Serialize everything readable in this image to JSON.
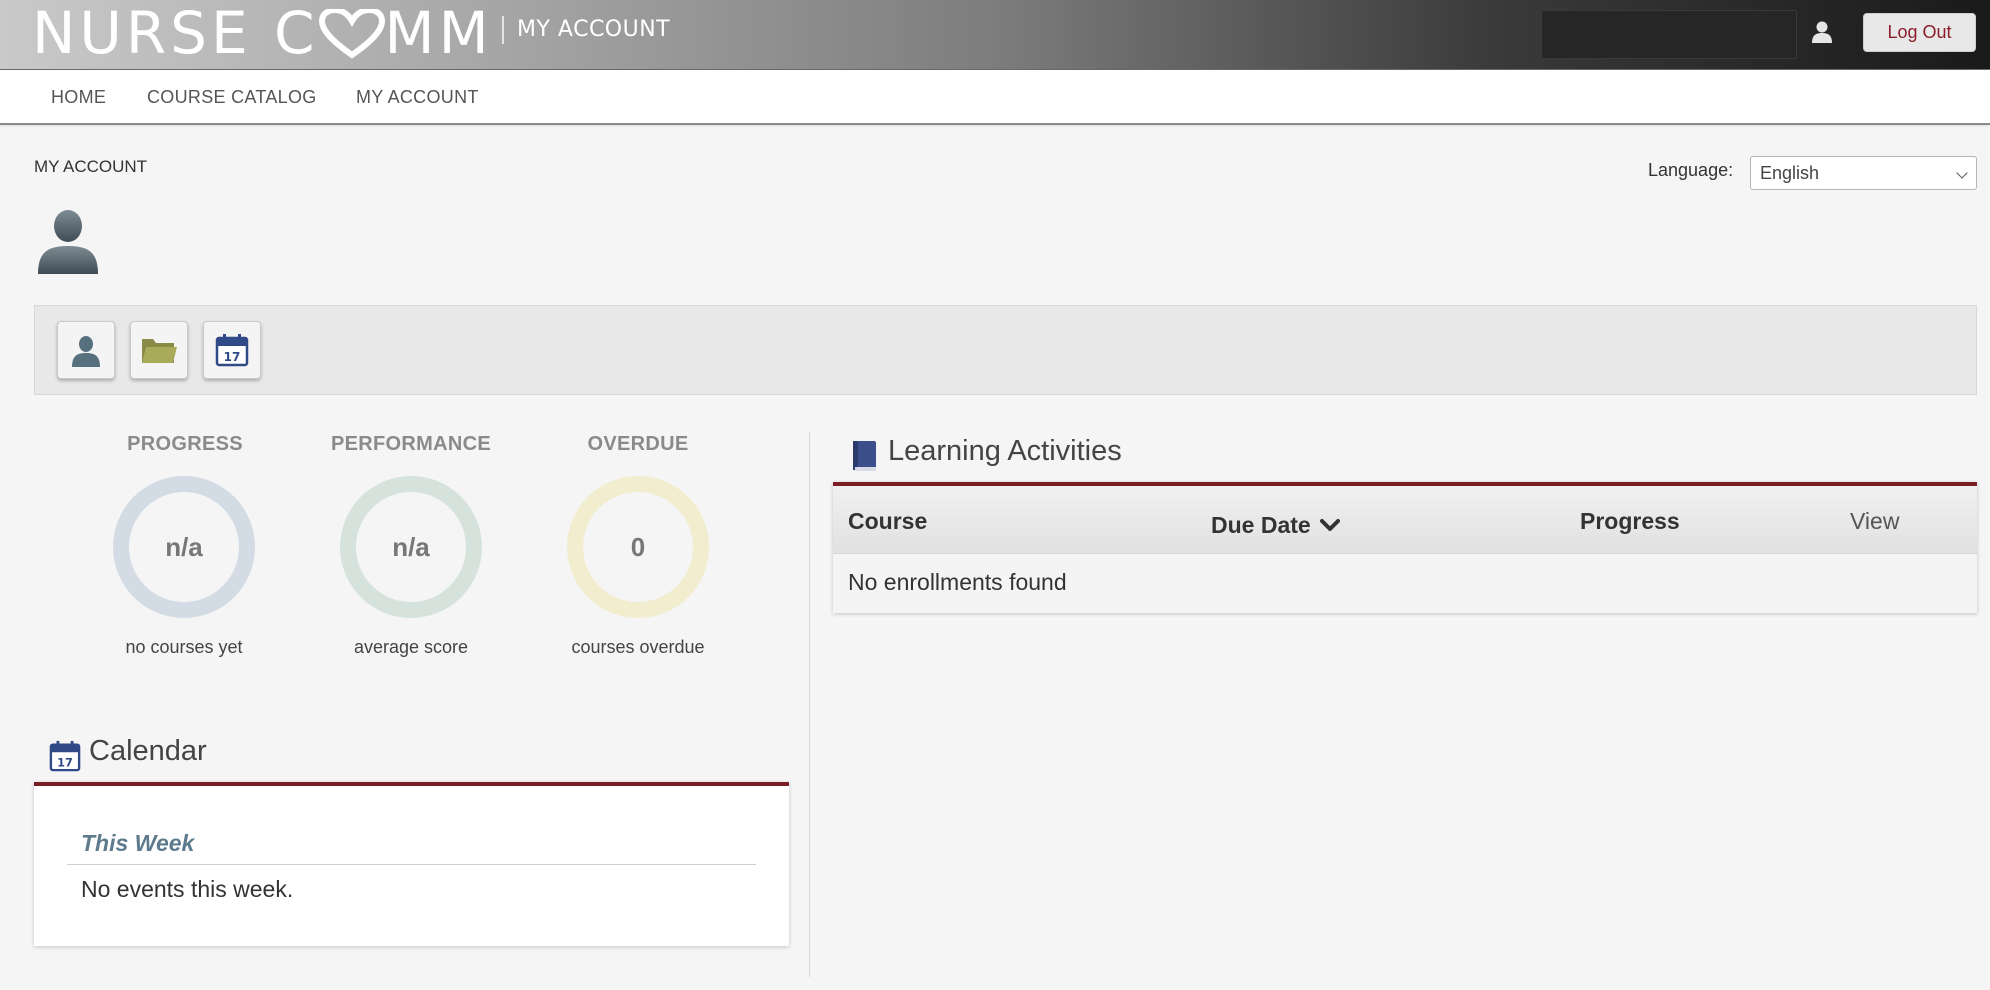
{
  "header": {
    "logo_text_left": "NURSE C",
    "logo_text_right": "MM",
    "section": "MY ACCOUNT",
    "logout_label": "Log Out"
  },
  "nav": {
    "items": [
      {
        "label": "HOME"
      },
      {
        "label": "COURSE CATALOG"
      },
      {
        "label": "MY ACCOUNT"
      }
    ]
  },
  "page": {
    "title": "MY ACCOUNT",
    "language_label": "Language:",
    "language_value": "English"
  },
  "stats": [
    {
      "label": "PROGRESS",
      "value": "n/a",
      "caption": "no courses yet",
      "color": "#d3dbe5"
    },
    {
      "label": "PERFORMANCE",
      "value": "n/a",
      "caption": "average score",
      "color": "#d6e3dc"
    },
    {
      "label": "OVERDUE",
      "value": "0",
      "caption": "courses overdue",
      "color": "#f2edcf"
    }
  ],
  "calendar": {
    "title": "Calendar",
    "week_label": "This Week",
    "empty_text": "No events this week.",
    "icon_day": "17"
  },
  "learning_activities": {
    "title": "Learning Activities",
    "columns": [
      "Course",
      "Due Date",
      "Progress",
      "View"
    ],
    "empty_text": "No enrollments found"
  },
  "colors": {
    "accent_rule": "#7b1e24",
    "logout_text": "#8b1e2b"
  }
}
